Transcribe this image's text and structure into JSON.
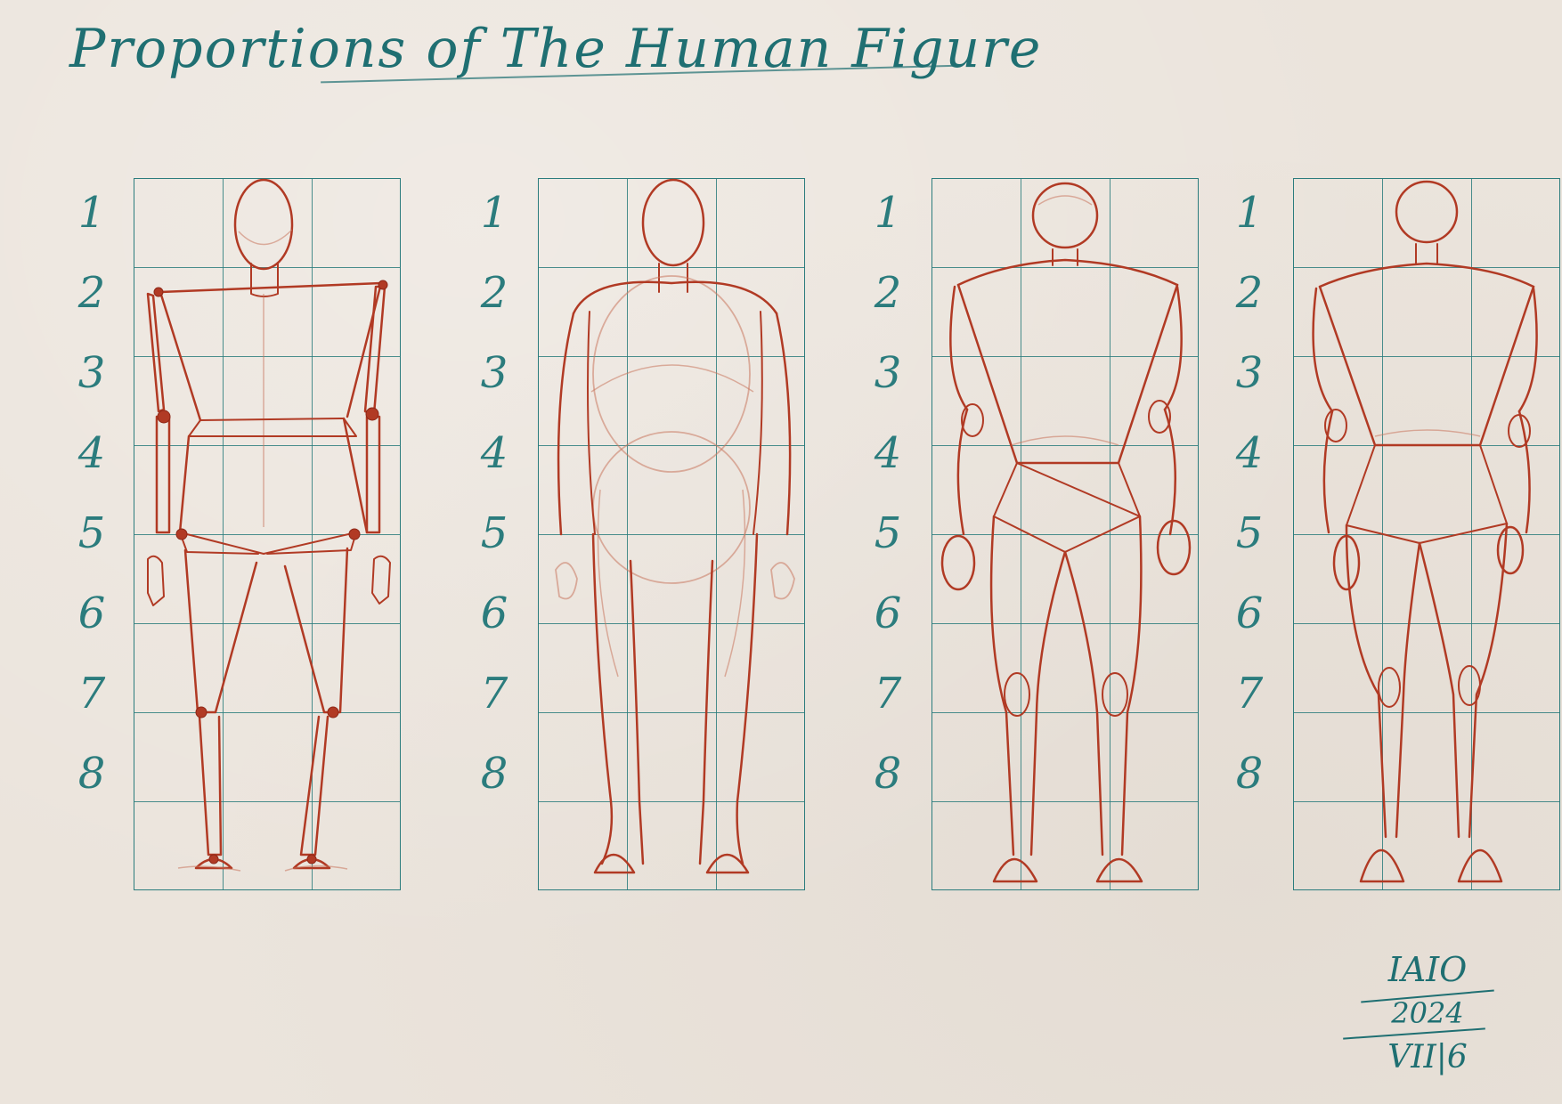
{
  "title": "Proportions of The Human Figure",
  "scale_numbers": [
    "1",
    "2",
    "3",
    "4",
    "5",
    "6",
    "7",
    "8"
  ],
  "figures": [
    {
      "view": "mannequin"
    },
    {
      "view": "front-volumes"
    },
    {
      "view": "male-frame"
    },
    {
      "view": "female-frame"
    }
  ],
  "signature": {
    "name": "IAIO",
    "year": "2024",
    "date": "VII|6"
  },
  "colors": {
    "grid": "#2b7c7d",
    "ink_teal": "#1f6f72",
    "sketch_red": "#b13a24",
    "paper": "#ebe4dc"
  }
}
